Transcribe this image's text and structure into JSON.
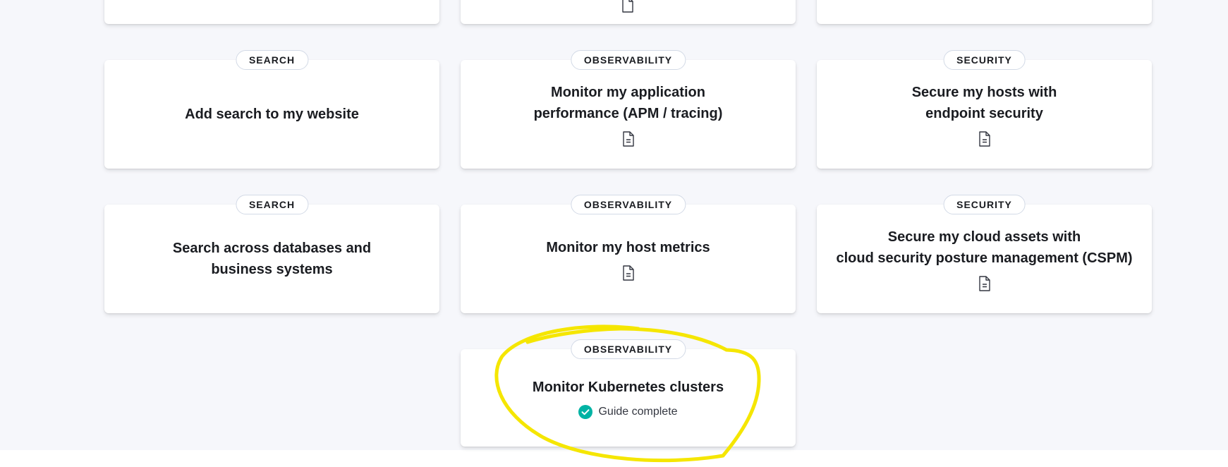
{
  "cards": [
    {
      "category": "SEARCH",
      "title": "Add search to my website",
      "has_doc_icon": false
    },
    {
      "category": "OBSERVABILITY",
      "title": "Monitor my application\nperformance (APM / tracing)",
      "has_doc_icon": true
    },
    {
      "category": "SECURITY",
      "title": "Secure my hosts with\nendpoint security",
      "has_doc_icon": true
    },
    {
      "category": "SEARCH",
      "title": "Search across databases and\nbusiness systems",
      "has_doc_icon": false
    },
    {
      "category": "OBSERVABILITY",
      "title": "Monitor my host metrics",
      "has_doc_icon": true
    },
    {
      "category": "SECURITY",
      "title": "Secure my cloud assets with\ncloud security posture management (CSPM)",
      "has_doc_icon": true
    },
    {
      "category": "OBSERVABILITY",
      "title": "Monitor Kubernetes clusters",
      "status": "Guide complete"
    }
  ],
  "colors": {
    "background": "#f6f7fb",
    "card": "#ffffff",
    "badge_border": "#d3dae6",
    "complete_check": "#00b3a4",
    "annotation": "#f5e600"
  },
  "icons": {
    "doc": "document-icon",
    "complete": "check-circle-icon"
  }
}
